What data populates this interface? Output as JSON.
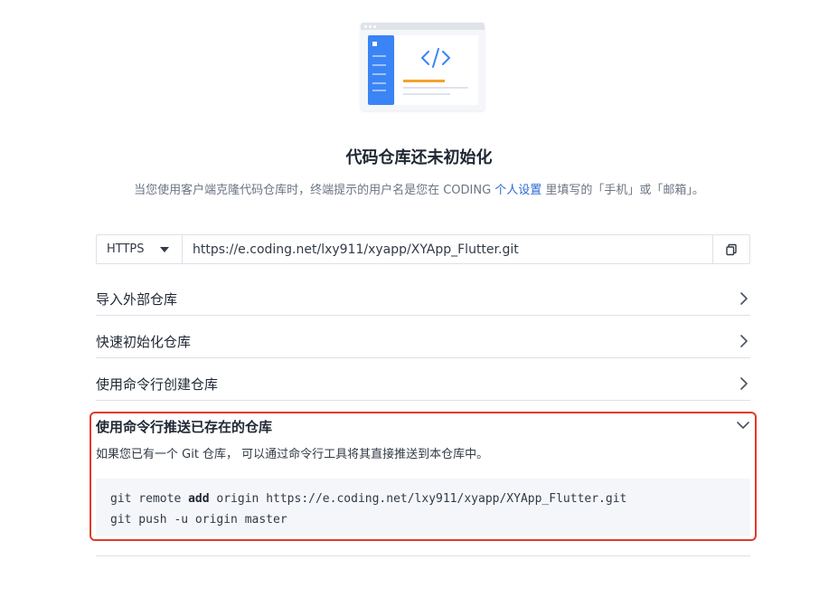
{
  "illustration": {
    "icon": "code-repo-illustration",
    "code_glyph": "</>",
    "accent": "#3b84f5",
    "highlight": "#f2a32d"
  },
  "header": {
    "title": "代码仓库还未初始化",
    "subtitle_before": "当您使用客户端克隆代码仓库时，终端提示的用户名是您在 CODING ",
    "subtitle_link": "个人设置",
    "subtitle_after": " 里填写的「手机」或「邮箱」。"
  },
  "clone": {
    "protocol": "HTTPS",
    "url": "https://e.coding.net/lxy911/xyapp/XYApp_Flutter.git",
    "copy_icon": "copy-icon"
  },
  "sections": [
    {
      "label": "导入外部仓库",
      "state": "collapsed"
    },
    {
      "label": "快速初始化仓库",
      "state": "collapsed"
    },
    {
      "label": "使用命令行创建仓库",
      "state": "collapsed"
    },
    {
      "label": "使用命令行推送已存在的仓库",
      "state": "expanded"
    }
  ],
  "expanded": {
    "description": "如果您已有一个 Git 仓库， 可以通过命令行工具将其直接推送到本仓库中。",
    "line1_pre": "git remote ",
    "line1_bold": "add",
    "line1_post": " origin https://e.coding.net/lxy911/xyapp/XYApp_Flutter.git",
    "line2": "git push -u origin master"
  },
  "colors": {
    "highlight_border": "#e03a2a",
    "link": "#2d6ad8"
  }
}
